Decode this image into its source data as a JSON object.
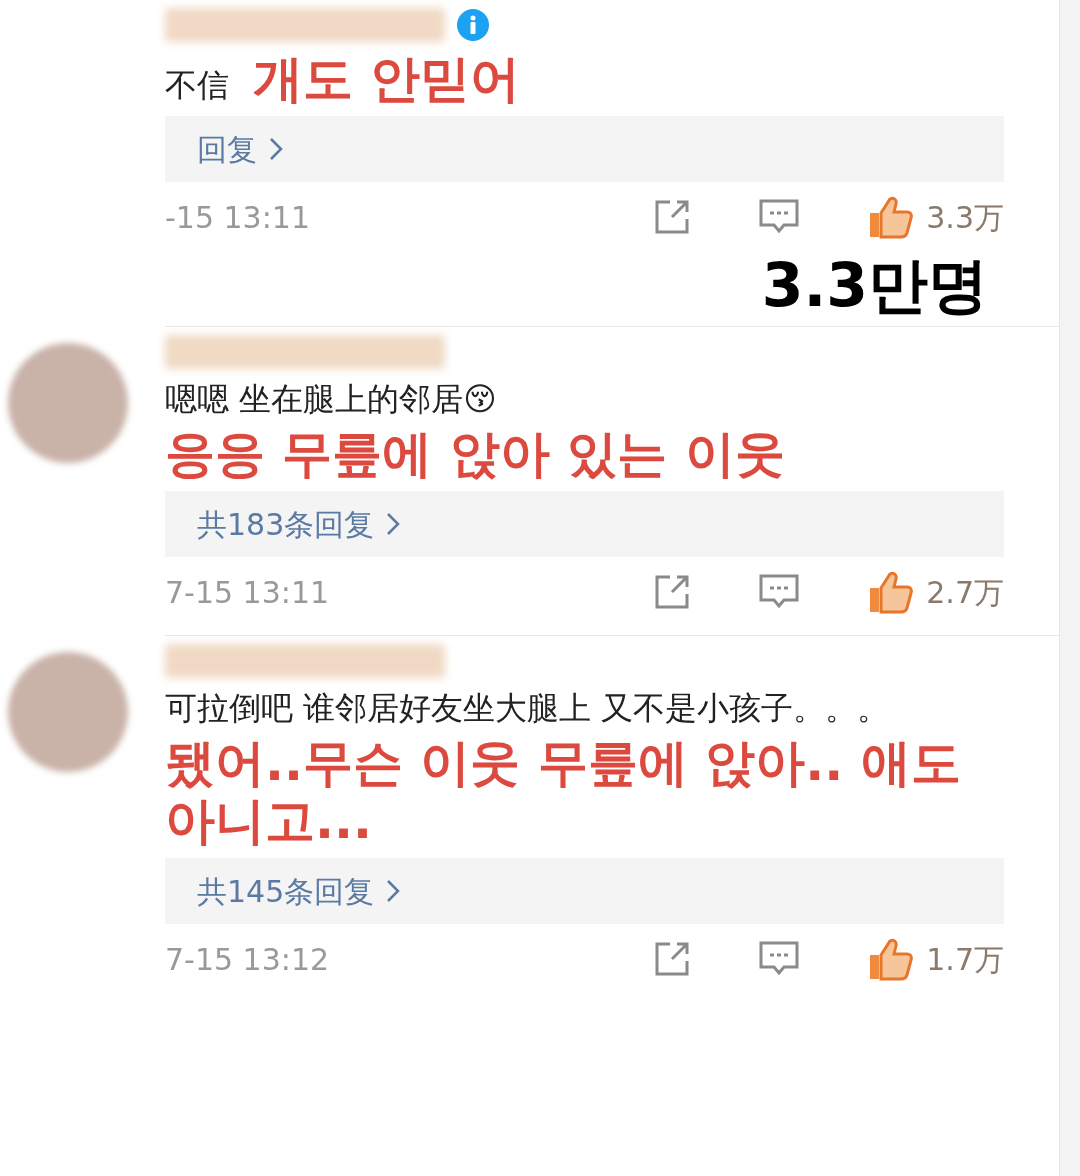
{
  "comments": [
    {
      "avatar": false,
      "verified": true,
      "text": "不信",
      "translation": "개도 안믿어",
      "replies": "回复",
      "time": "-15 13:11",
      "likes": "3.3万",
      "note": "3.3만명"
    },
    {
      "avatar": true,
      "verified": false,
      "text": "嗯嗯 坐在腿上的邻居😚",
      "translation": "응응 무릎에 앉아 있는 이웃",
      "replies": "共183条回复",
      "time": "7-15 13:11",
      "likes": "2.7万"
    },
    {
      "avatar": true,
      "verified": false,
      "text": "可拉倒吧 谁邻居好友坐大腿上 又不是小孩子。。。",
      "translation": "됐어..무슨 이웃 무릎에 앉아.. 애도 아니고...",
      "replies": "共145条回复",
      "time": "7-15 13:12",
      "likes": "1.7万"
    }
  ]
}
